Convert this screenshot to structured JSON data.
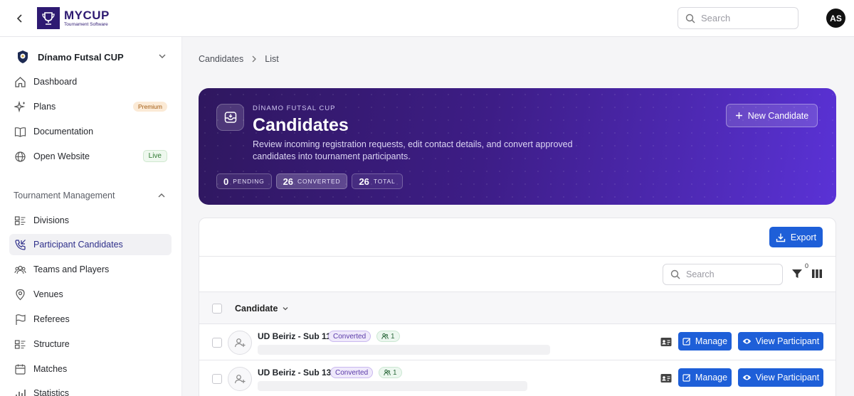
{
  "topbar": {
    "brand": "MYCUP",
    "brand_sub": "Tournament Software",
    "search_placeholder": "Search",
    "user_initials": "AS"
  },
  "sidebar": {
    "org_name": "Dínamo Futsal CUP",
    "items": [
      {
        "label": "Dashboard"
      },
      {
        "label": "Plans",
        "badge": "Premium"
      },
      {
        "label": "Documentation"
      },
      {
        "label": "Open Website",
        "badge": "Live"
      }
    ],
    "section_title": "Tournament Management",
    "section_items": [
      {
        "label": "Divisions"
      },
      {
        "label": "Participant Candidates",
        "active": true
      },
      {
        "label": "Teams and Players"
      },
      {
        "label": "Venues"
      },
      {
        "label": "Referees"
      },
      {
        "label": "Structure"
      },
      {
        "label": "Matches"
      },
      {
        "label": "Statistics"
      }
    ]
  },
  "breadcrumb": {
    "parent": "Candidates",
    "current": "List"
  },
  "hero": {
    "eyebrow": "DÍNAMO FUTSAL CUP",
    "title": "Candidates",
    "description": "Review incoming registration requests, edit contact details, and convert approved candidates into tournament participants.",
    "new_button": "New Candidate",
    "stats": [
      {
        "value": "0",
        "label": "PENDING"
      },
      {
        "value": "26",
        "label": "CONVERTED"
      },
      {
        "value": "26",
        "label": "TOTAL"
      }
    ]
  },
  "table": {
    "export_label": "Export",
    "search_placeholder": "Search",
    "filter_count": "0",
    "column_header": "Candidate",
    "rows": [
      {
        "name": "UD Beiriz - Sub 11",
        "status": "Converted",
        "participants": "1"
      },
      {
        "name": "UD Beiriz - Sub 13",
        "status": "Converted",
        "participants": "1"
      }
    ],
    "manage_label": "Manage",
    "view_label": "View Participant"
  },
  "colors": {
    "accent": "#1e5fd8",
    "brand": "#2e1a72",
    "hero_start": "#2f175f",
    "hero_end": "#5a32d6"
  }
}
